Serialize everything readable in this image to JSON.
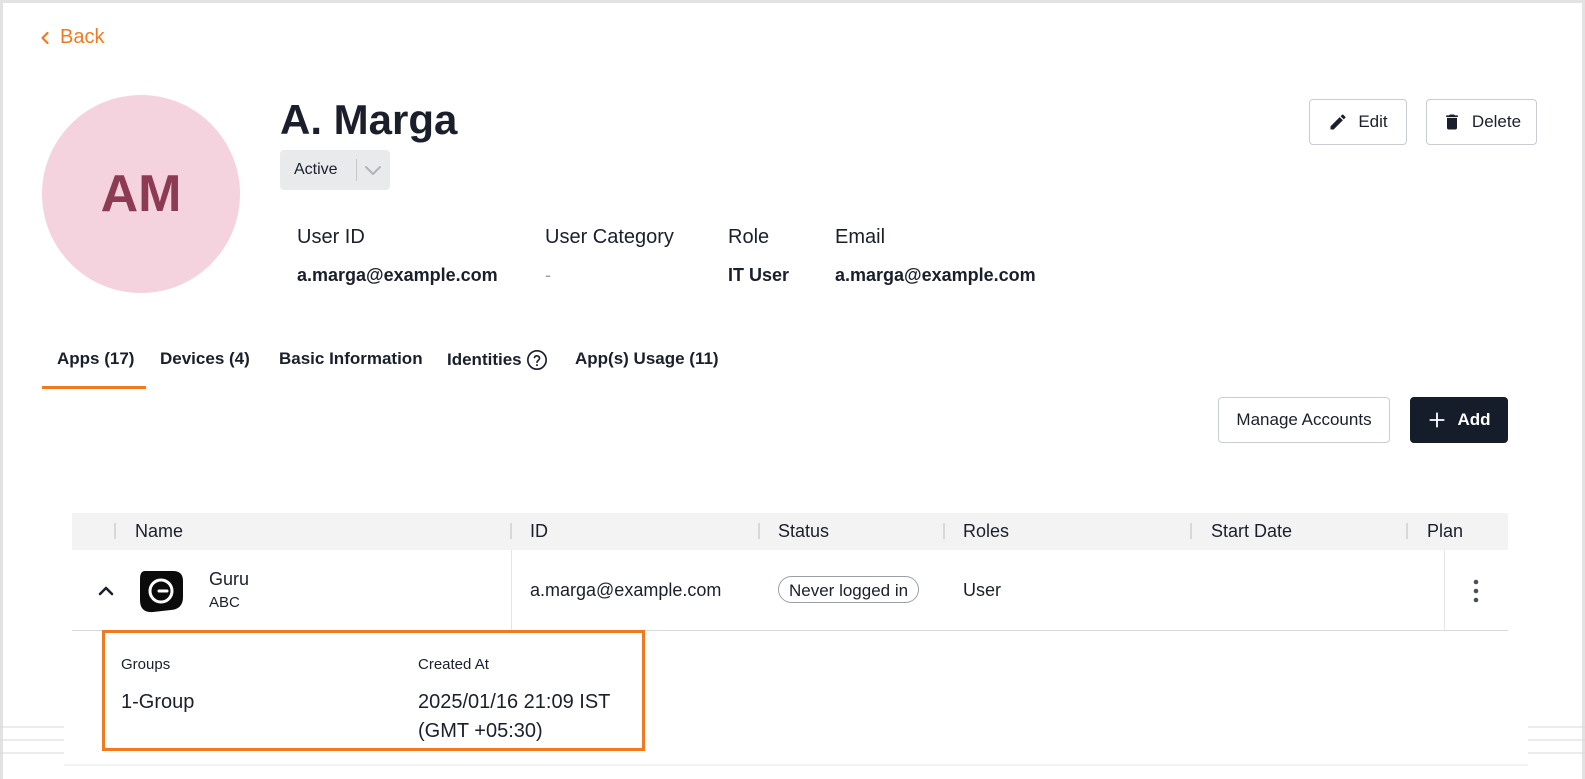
{
  "nav": {
    "back_label": "Back"
  },
  "user": {
    "initials": "AM",
    "name": "A. Marga",
    "status": "Active",
    "fields": [
      {
        "label": "User ID",
        "value": "a.marga@example.com"
      },
      {
        "label": "User Category",
        "value": "-"
      },
      {
        "label": "Role",
        "value": "IT User"
      },
      {
        "label": "Email",
        "value": "a.marga@example.com"
      }
    ]
  },
  "actions": {
    "edit_label": "Edit",
    "delete_label": "Delete",
    "manage_label": "Manage Accounts",
    "add_label": "Add"
  },
  "tabs": [
    {
      "label": "Apps (17)",
      "active": true
    },
    {
      "label": "Devices (4)"
    },
    {
      "label": "Basic Information"
    },
    {
      "label": "Identities"
    },
    {
      "label": "App(s) Usage (11)"
    }
  ],
  "table": {
    "columns": [
      "Name",
      "ID",
      "Status",
      "Roles",
      "Start Date",
      "Plan"
    ],
    "rows": [
      {
        "app_name": "Guru",
        "app_sub": "ABC",
        "id": "a.marga@example.com",
        "status": "Never logged in",
        "roles": "User",
        "start_date": "",
        "plan": ""
      }
    ],
    "detail": {
      "groups_label": "Groups",
      "groups_value": "1-Group",
      "created_label": "Created At",
      "created_value_line1": "2025/01/16 21:09 IST",
      "created_value_line2": "(GMT +05:30)"
    }
  },
  "colors": {
    "accent": "#f07a22",
    "avatar_bg": "#f5d3de",
    "avatar_text": "#8d3a55",
    "primary_button": "#151d2a"
  }
}
